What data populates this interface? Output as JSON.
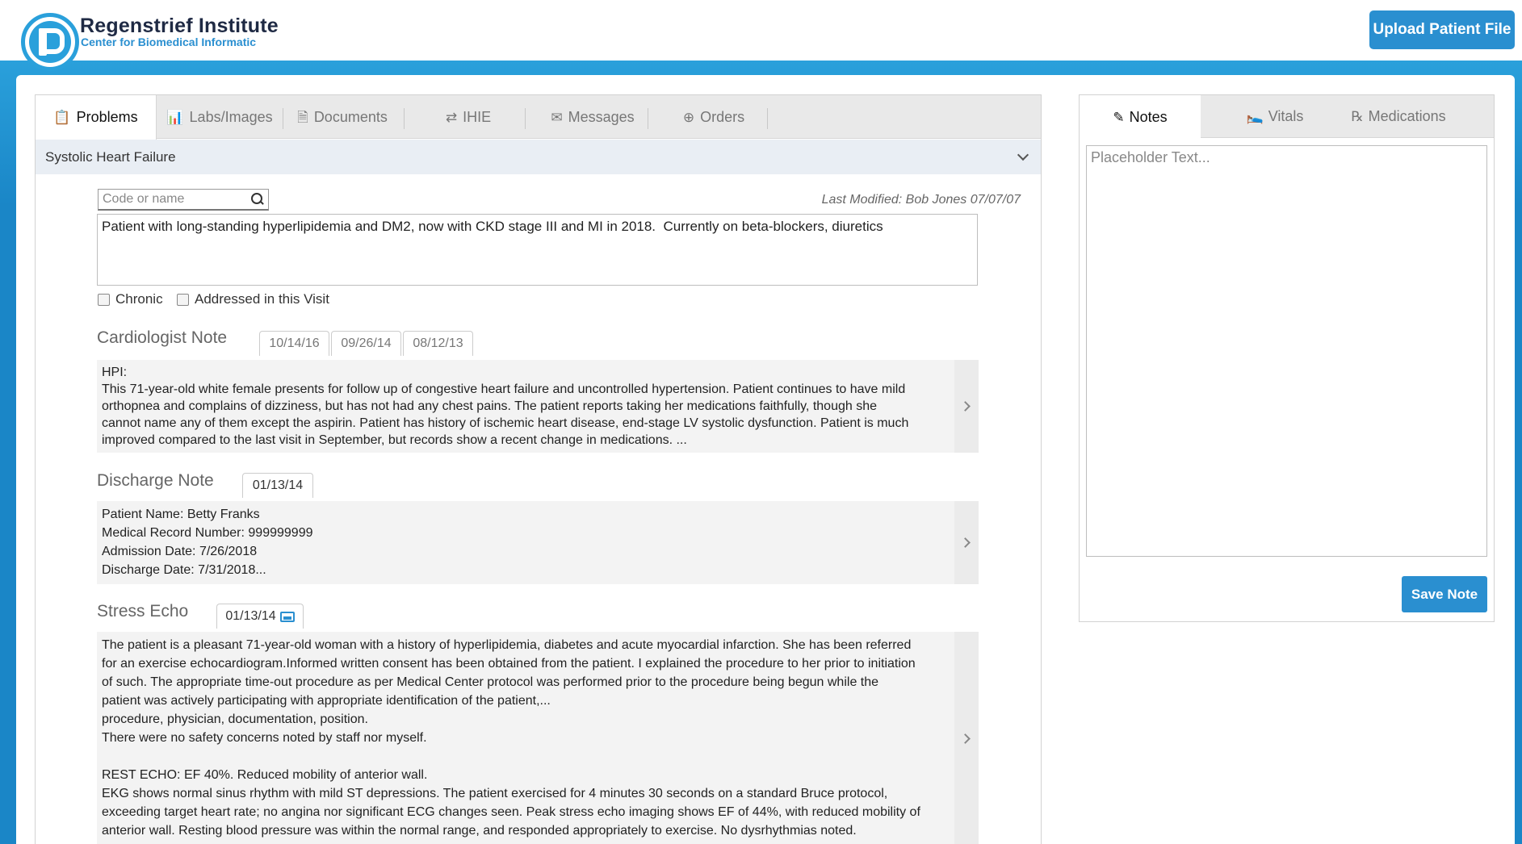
{
  "header": {
    "brand_title": "Regenstrief Institute",
    "brand_subtitle": "Center for Biomedical Informatic",
    "upload_button": "Upload Patient File"
  },
  "left_tabs": [
    {
      "label": "Problems",
      "icon": "clipboard-icon",
      "active": true
    },
    {
      "label": "Labs/Images",
      "icon": "bar-chart-icon"
    },
    {
      "label": "Documents",
      "icon": "document-icon"
    },
    {
      "label": "IHIE",
      "icon": "shuffle-icon"
    },
    {
      "label": "Messages",
      "icon": "envelope-icon"
    },
    {
      "label": "Orders",
      "icon": "plus-circle-icon"
    }
  ],
  "problem": {
    "title": "Systolic Heart Failure",
    "search_placeholder": "Code or name",
    "last_modified": "Last Modified: Bob Jones 07/07/07",
    "text": "Patient with long-standing hyperlipidemia and DM2, now with CKD stage III and MI in 2018.  Currently on beta-blockers, diuretics",
    "chronic_label": "Chronic",
    "addressed_label": "Addressed in this Visit"
  },
  "sections": {
    "cardiologist": {
      "title": "Cardiologist Note",
      "dates": [
        "10/14/16",
        "09/26/14",
        "08/12/13"
      ],
      "text": "HPI:\nThis 71-year-old white female presents for follow up of congestive heart failure and uncontrolled hypertension. Patient continues to have mild\northopnea and complains of dizziness, but has not had any chest pains. The patient reports taking her medications faithfully, though she\ncannot name any of them except the aspirin. Patient has history of ischemic heart disease, end-stage LV systolic dysfunction. Patient is much\nimproved compared to the last visit in September, but records show a recent change in medications. ..."
    },
    "discharge": {
      "title": "Discharge Note",
      "dates": [
        "01/13/14"
      ],
      "text": "Patient Name: Betty Franks\nMedical Record Number: 999999999\nAdmission Date: 7/26/2018\nDischarge Date: 7/31/2018..."
    },
    "stress_echo": {
      "title": "Stress Echo",
      "dates": [
        "01/13/14"
      ],
      "text": "The patient is a pleasant 71-year-old woman with a history of hyperlipidemia, diabetes and acute myocardial infarction. She has been referred\nfor an exercise echocardiogram.Informed written consent has been obtained from the patient. I explained the procedure to her prior to initiation\nof such. The appropriate time-out procedure as per Medical Center protocol was performed prior to the procedure being begun while the\npatient was actively participating with appropriate identification of the patient,...\nprocedure, physician, documentation, position.\nThere were no safety concerns noted by staff nor myself.\n\nREST ECHO: EF 40%. Reduced mobility of anterior wall.\nEKG shows normal sinus rhythm with mild ST depressions. The patient exercised for 4 minutes 30 seconds on a standard Bruce protocol,\nexceeding target heart rate; no angina nor significant ECG changes seen. Peak stress echo imaging shows EF of 44%, with reduced mobility of\nanterior wall. Resting blood pressure was within the normal range, and responded appropriately to exercise. No dysrhythmias noted."
    }
  },
  "right_tabs": [
    {
      "label": "Notes",
      "icon": "pencil-icon",
      "active": true
    },
    {
      "label": "Vitals",
      "icon": "bed-icon"
    },
    {
      "label": "Medications",
      "icon": "prescription-icon"
    }
  ],
  "notes": {
    "placeholder": "Placeholder Text...",
    "save_button": "Save Note"
  },
  "colors": {
    "accent": "#2a8fd0",
    "header_band": "#1a86c7",
    "tab_bg": "#e9e9e9",
    "problem_header_bg": "#e9eef4"
  }
}
